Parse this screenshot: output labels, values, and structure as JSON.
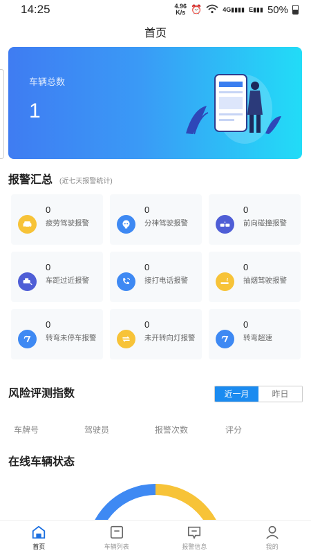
{
  "status_bar": {
    "time": "14:25",
    "speed_value": "4.96",
    "speed_unit": "K/s",
    "network": "4G",
    "network2": "E",
    "battery": "50%"
  },
  "header": {
    "title": "首页"
  },
  "hero": {
    "label": "车辆总数",
    "value": "1"
  },
  "alarm_summary": {
    "title": "报警汇总",
    "subtitle": "(近七天报警统计)",
    "items": [
      {
        "count": "0",
        "label": "疲劳驾驶报警",
        "icon": "fatigue-driving-icon",
        "color": "#f7c338"
      },
      {
        "count": "0",
        "label": "分神驾驶报警",
        "icon": "distracted-driving-icon",
        "color": "#3e89f3"
      },
      {
        "count": "0",
        "label": "前向碰撞报警",
        "icon": "forward-collision-icon",
        "color": "#4f5ed6"
      },
      {
        "count": "0",
        "label": "车距过近报警",
        "icon": "close-distance-icon",
        "color": "#4f5ed6"
      },
      {
        "count": "0",
        "label": "接打电话报警",
        "icon": "phone-call-icon",
        "color": "#3e89f3"
      },
      {
        "count": "0",
        "label": "抽烟驾驶报警",
        "icon": "smoking-icon",
        "color": "#f7c338"
      },
      {
        "count": "0",
        "label": "转弯未停车报警",
        "icon": "turn-no-stop-icon",
        "color": "#3e89f3"
      },
      {
        "count": "0",
        "label": "未开转向灯报警",
        "icon": "turn-signal-icon",
        "color": "#f7c338"
      },
      {
        "count": "0",
        "label": "转弯超速",
        "icon": "turn-speeding-icon",
        "color": "#3e89f3"
      }
    ]
  },
  "risk": {
    "title": "风险评测指数",
    "tabs": [
      {
        "label": "近一月",
        "active": true
      },
      {
        "label": "昨日",
        "active": false
      }
    ],
    "columns": [
      "车牌号",
      "驾驶员",
      "报警次数",
      "评分"
    ]
  },
  "online": {
    "title": "在线车辆状态"
  },
  "tabbar": [
    {
      "label": "首页",
      "icon": "home-icon",
      "active": true
    },
    {
      "label": "车辆列表",
      "icon": "vehicle-list-icon",
      "active": false
    },
    {
      "label": "报警信息",
      "icon": "alarm-message-icon",
      "active": false
    },
    {
      "label": "我的",
      "icon": "profile-icon",
      "active": false
    }
  ],
  "colors": {
    "accent": "#1b8bf0",
    "gauge_blue": "#3e89f3",
    "gauge_yellow": "#f7c338"
  }
}
